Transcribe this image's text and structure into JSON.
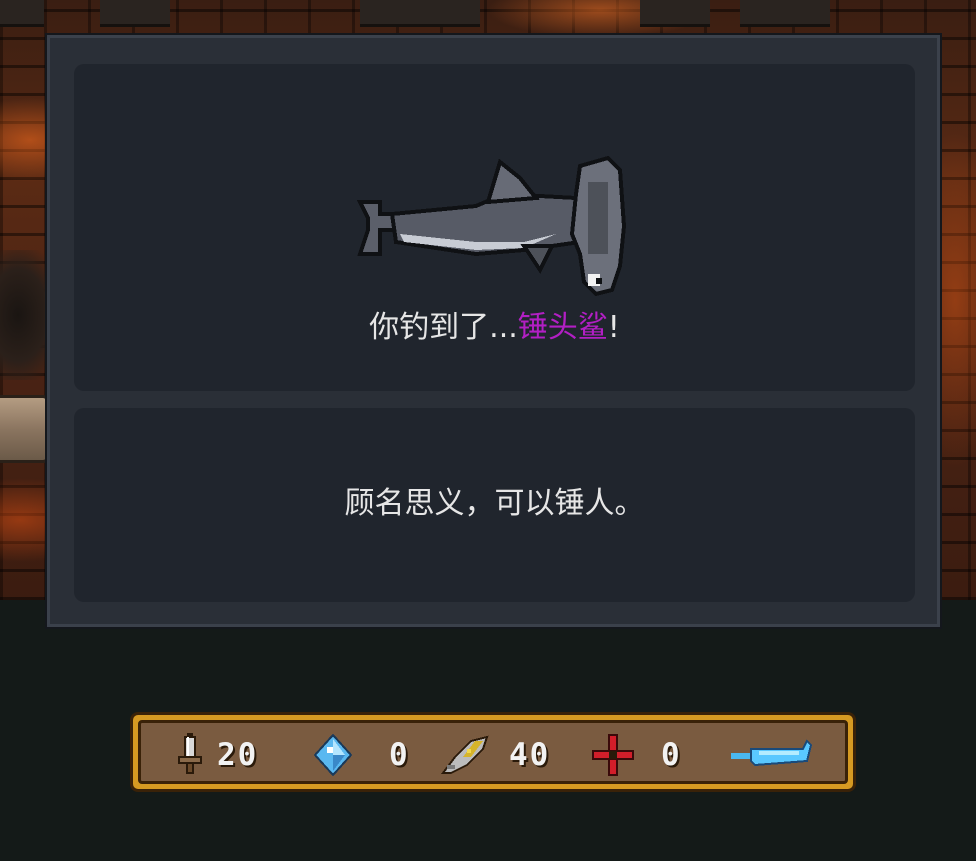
{
  "dialog": {
    "caught_prefix": "你钓到了...",
    "fish_name": "锤头鲨",
    "caught_suffix": "!",
    "description": "顾名思义，可以锤人。",
    "fish_icon": "hammerhead-shark-sprite",
    "fish_name_color": "#b21fc4"
  },
  "hud": {
    "resources": [
      {
        "icon": "sword-icon",
        "value": "20"
      },
      {
        "icon": "blue-gem-icon",
        "value": "0"
      },
      {
        "icon": "feather-quill-icon",
        "value": "40"
      },
      {
        "icon": "red-cross-icon",
        "value": "0"
      },
      {
        "icon": "blue-weapon-icon",
        "value": ""
      }
    ],
    "frame_color": "#d69a22",
    "fill_color": "#7a5b40"
  }
}
